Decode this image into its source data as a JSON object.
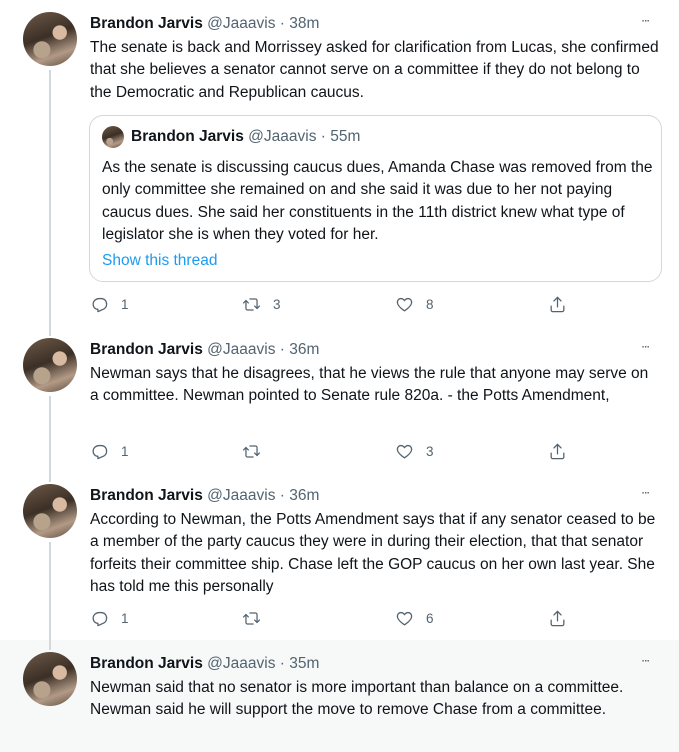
{
  "thread": {
    "tweets": [
      {
        "author": "Brandon Jarvis",
        "handle": "@Jaaavis",
        "separator": "·",
        "time": "38m",
        "text": "The senate is back and Morrissey asked for clarification from Lucas, she confirmed that she believes a senator cannot serve on a committee if they do not belong to the Democratic and Republican caucus.",
        "quote": {
          "author": "Brandon Jarvis",
          "handle": "@Jaaavis",
          "separator": "·",
          "time": "55m",
          "text": "As the senate is discussing caucus dues, Amanda Chase was removed from the only committee she remained on and she said it was due to her not paying caucus dues. She said her constituents in the 11th district knew what type of legislator she is when they voted for her.",
          "link": "Show this thread"
        },
        "replies": "1",
        "retweets": "3",
        "likes": "8"
      },
      {
        "author": "Brandon Jarvis",
        "handle": "@Jaaavis",
        "separator": "·",
        "time": "36m",
        "text": "Newman says that he disagrees, that he views the rule that anyone may serve on a committee. Newman pointed to Senate rule 820a. - the Potts Amendment,",
        "replies": "1",
        "retweets": "",
        "likes": "3"
      },
      {
        "author": "Brandon Jarvis",
        "handle": "@Jaaavis",
        "separator": "·",
        "time": "36m",
        "text": "According to Newman, the Potts Amendment says that if any senator ceased to be a member of the party caucus they were in during their election, that that senator forfeits their committee ship. Chase left the GOP caucus on her own last year. She has told me this personally",
        "replies": "1",
        "retweets": "",
        "likes": "6"
      },
      {
        "author": "Brandon Jarvis",
        "handle": "@Jaaavis",
        "separator": "·",
        "time": "35m",
        "text": "Newman said that no senator is more important than balance on a committee. Newman said he will support the move to remove Chase from a committee."
      }
    ],
    "icons": {
      "more": "more-horizontal-icon",
      "reply": "reply-icon",
      "retweet": "retweet-icon",
      "like": "like-heart-icon",
      "share": "share-icon"
    },
    "colors": {
      "link": "#1d9bf0",
      "secondary_text": "#536471",
      "thread_line": "#cfd9de",
      "highlight_bg": "#f7f9f9"
    }
  }
}
